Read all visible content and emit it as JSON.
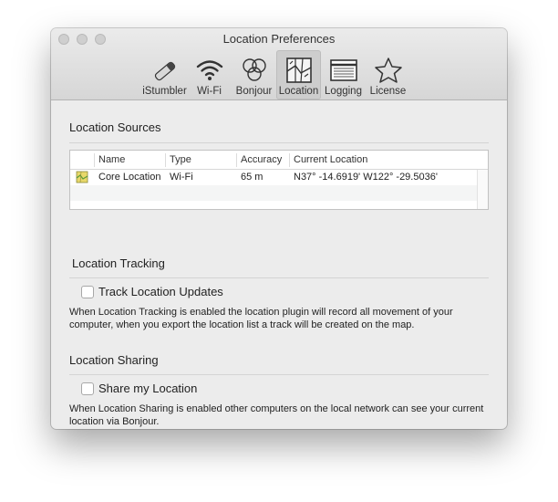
{
  "window": {
    "title": "Location Preferences"
  },
  "toolbar": {
    "items": [
      {
        "label": "iStumbler",
        "icon": "istumbler-icon"
      },
      {
        "label": "Wi-Fi",
        "icon": "wifi-icon"
      },
      {
        "label": "Bonjour",
        "icon": "bonjour-icon"
      },
      {
        "label": "Location",
        "icon": "location-map-icon",
        "active": true
      },
      {
        "label": "Logging",
        "icon": "logging-icon"
      },
      {
        "label": "License",
        "icon": "license-star-icon"
      }
    ]
  },
  "sources": {
    "title": "Location Sources",
    "columns": [
      "Name",
      "Type",
      "Accuracy",
      "Current Location"
    ],
    "rows": [
      {
        "name": "Core Location",
        "type": "Wi-Fi",
        "accuracy": "65 m",
        "location": "N37° -14.6919' W122° -29.5036'"
      }
    ]
  },
  "tracking": {
    "title": "Location Tracking",
    "checkbox_label": "Track Location Updates",
    "checked": false,
    "description": "When Location Tracking is enabled the location plugin will record all movement of your computer, when you export the location list a track will be created on the map."
  },
  "sharing": {
    "title": "Location Sharing",
    "checkbox_label": "Share my Location",
    "checked": false,
    "description": "When Location Sharing is enabled other computers on the local network can see your current location via Bonjour."
  }
}
